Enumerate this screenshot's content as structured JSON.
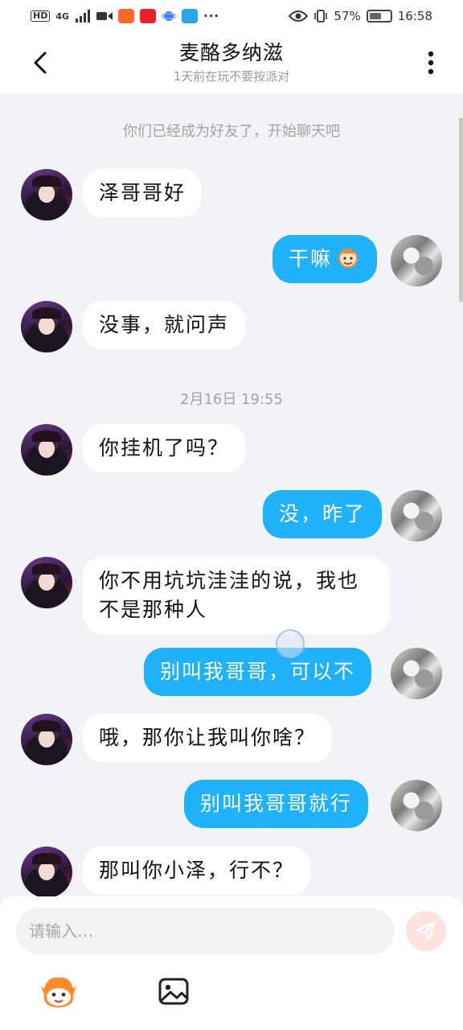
{
  "status_bar": {
    "hd": "HD",
    "network": "4G",
    "battery_percent_label": "57%",
    "battery_level": 0.57,
    "time": "16:58",
    "more": "···"
  },
  "header": {
    "back_icon": "chevron-left-icon",
    "title": "麦酪多纳滋",
    "subtitle": "1天前在玩不要按派对",
    "more_icon": "vertical-dots-icon"
  },
  "chat": {
    "system_friend": "你们已经成为好友了，开始聊天吧",
    "timestamp": "2月16日 19:55",
    "messages": [
      {
        "side": "in",
        "text": "泽哥哥好"
      },
      {
        "side": "out",
        "text": "干嘛",
        "emoji": "sticker-face-icon"
      },
      {
        "side": "in",
        "text": "没事，就问声"
      },
      {
        "side": "in",
        "text": "你挂机了吗？"
      },
      {
        "side": "out",
        "text": "没，昨了"
      },
      {
        "side": "in",
        "text": "你不用坑坑洼洼的说，我也不是那种人"
      },
      {
        "side": "out",
        "text": "别叫我哥哥，可以不"
      },
      {
        "side": "in",
        "text": "哦，那你让我叫你啥？"
      },
      {
        "side": "out",
        "text": "别叫我哥哥就行"
      },
      {
        "side": "in",
        "text": "那叫你小泽，行不？"
      }
    ]
  },
  "input": {
    "placeholder": "请输入…",
    "send_icon": "send-icon",
    "sticker_icon": "sticker-face-icon",
    "image_icon": "image-icon"
  },
  "colors": {
    "outgoing_bubble": "#1fb1fa",
    "incoming_bubble": "#ffffff",
    "background": "#f2f3f6",
    "send_button": "#fde2df"
  }
}
